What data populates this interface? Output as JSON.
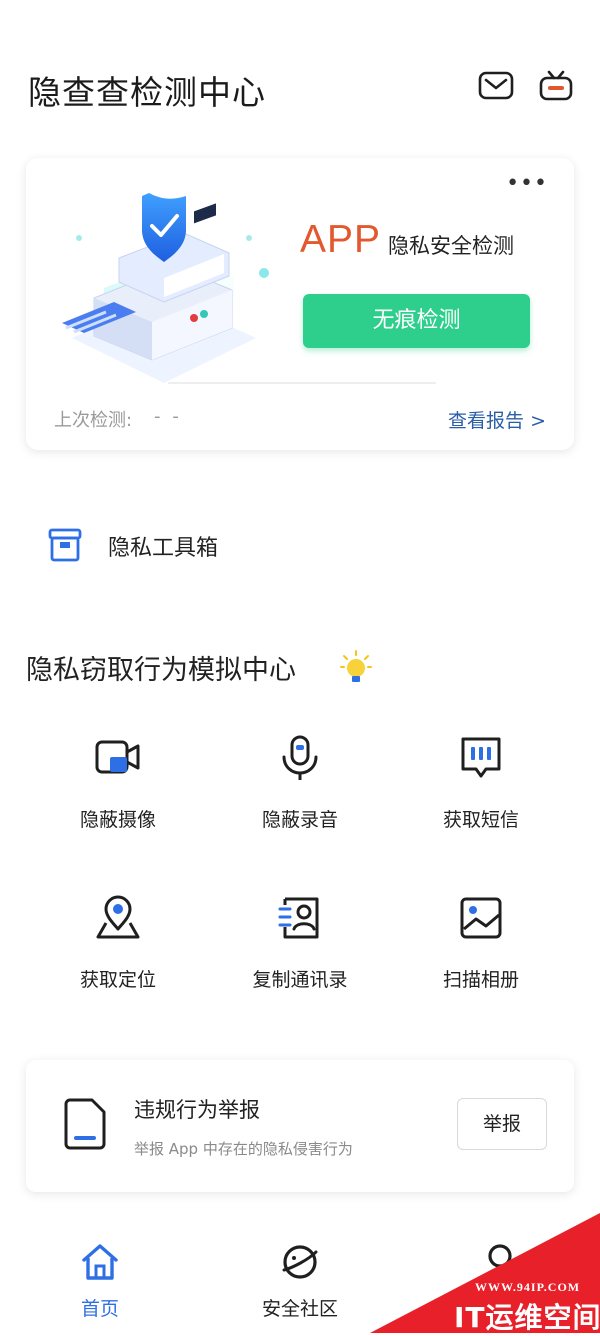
{
  "header": {
    "title": "隐查查检测中心",
    "icons": [
      "mail-icon",
      "tv-icon"
    ]
  },
  "detection_card": {
    "more_icon": "more-dots-icon",
    "app_label": "APP",
    "subtitle": "隐私安全检测",
    "scan_button": "无痕检测",
    "last_check_label": "上次检测:",
    "last_check_value": "- -",
    "view_report": "查看报告 >"
  },
  "toolbox": {
    "label": "隐私工具箱",
    "icon": "toolbox-icon"
  },
  "simulation": {
    "title": "隐私窃取行为模拟中心",
    "title_icon": "lightbulb-icon",
    "features": [
      {
        "label": "隐蔽摄像",
        "icon": "video-camera-icon"
      },
      {
        "label": "隐蔽录音",
        "icon": "microphone-icon"
      },
      {
        "label": "获取短信",
        "icon": "message-icon"
      },
      {
        "label": "获取定位",
        "icon": "location-pin-icon"
      },
      {
        "label": "复制通讯录",
        "icon": "contacts-icon"
      },
      {
        "label": "扫描相册",
        "icon": "photo-album-icon"
      }
    ]
  },
  "report": {
    "title": "违规行为举报",
    "description": "举报 App 中存在的隐私侵害行为",
    "button": "举报",
    "icon": "document-icon"
  },
  "bottom_nav": {
    "items": [
      {
        "label": "首页",
        "icon": "home-icon",
        "active": true
      },
      {
        "label": "安全社区",
        "icon": "planet-icon",
        "active": false
      },
      {
        "label": "",
        "icon": "profile-icon",
        "active": false
      }
    ]
  },
  "watermark": {
    "url": "WWW.94IP.COM",
    "text": "IT运维空间"
  },
  "colors": {
    "accent_green": "#2ecf8c",
    "app_orange": "#e2582f",
    "link_blue": "#2a5ea7",
    "icon_blue": "#2f6fe6",
    "watermark_red": "#e8202a"
  }
}
